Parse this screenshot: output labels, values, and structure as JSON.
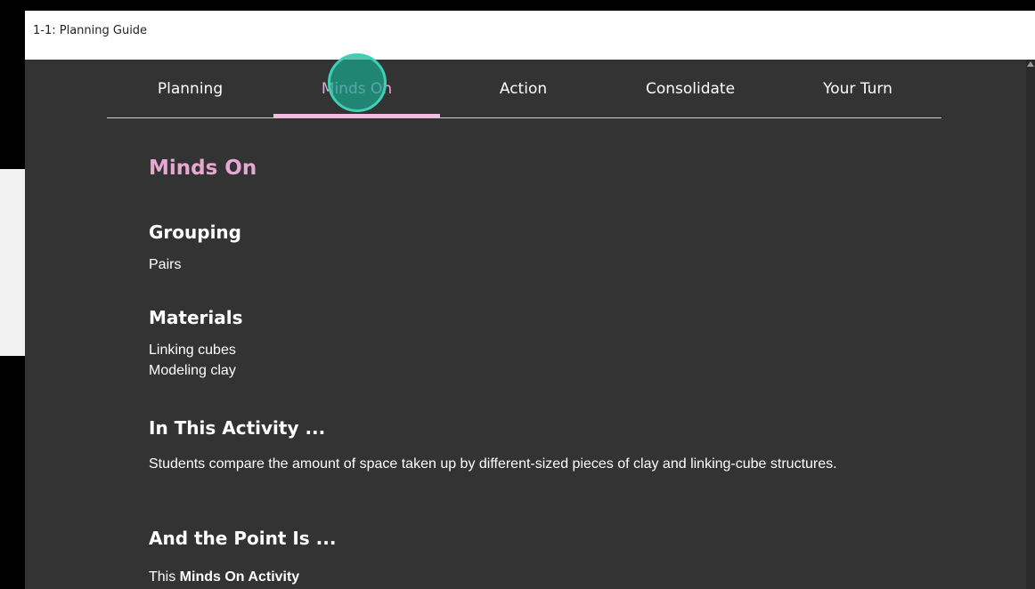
{
  "window": {
    "title": "1-1: Planning Guide"
  },
  "tabs": [
    {
      "label": "Planning",
      "active": false
    },
    {
      "label": "Minds On",
      "active": true
    },
    {
      "label": "Action",
      "active": false
    },
    {
      "label": "Consolidate",
      "active": false
    },
    {
      "label": "Your Turn",
      "active": false
    }
  ],
  "section": {
    "heading": "Minds On",
    "grouping": {
      "heading": "Grouping",
      "text": "Pairs"
    },
    "materials": {
      "heading": "Materials",
      "items": [
        "Linking cubes",
        "Modeling clay"
      ]
    },
    "activity": {
      "heading": "In This Activity ...",
      "text": "Students compare the amount of space taken up by different-sized pieces of clay and linking-cube structures."
    },
    "point": {
      "heading": "And the Point Is ...",
      "text_prefix": "This ",
      "text_bold": "Minds On Activity"
    }
  },
  "colors": {
    "accent": "#e7a9d2",
    "panel": "#333333",
    "cursor": "#1aa890"
  },
  "icons": {
    "scroll_up": "triangle-up"
  }
}
